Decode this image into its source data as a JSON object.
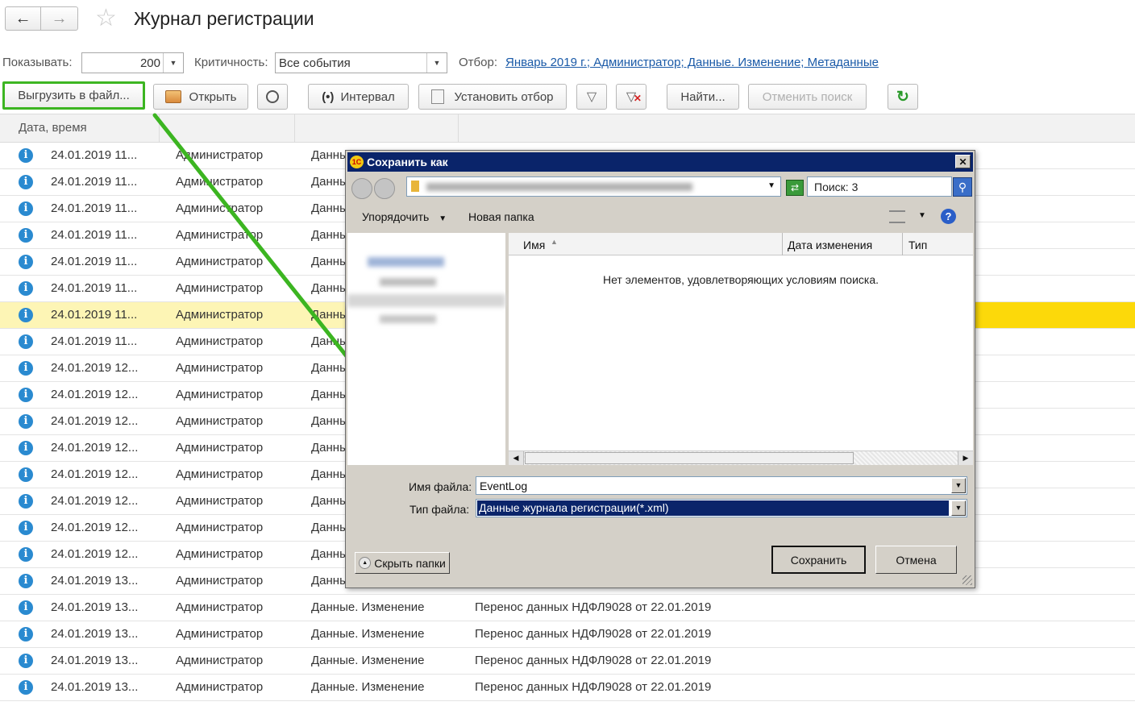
{
  "header": {
    "title": "Журнал регистрации"
  },
  "filters": {
    "show_label": "Показывать:",
    "show_value": "200",
    "severity_label": "Критичность:",
    "severity_value": "Все события",
    "filter_label": "Отбор:",
    "filter_value": "Январь 2019 г.; Администратор; Данные. Изменение; Метаданные"
  },
  "toolbar": {
    "export": "Выгрузить в файл...",
    "open": "Открыть",
    "interval": "Интервал",
    "set_filter": "Установить отбор",
    "find": "Найти...",
    "cancel_search": "Отменить поиск"
  },
  "table": {
    "columns": [
      "Дата, время"
    ],
    "rows": [
      {
        "date": "24.01.2019 11...",
        "user": "Администратор",
        "event": "Данные. Изменение",
        "comment": ""
      },
      {
        "date": "24.01.2019 11...",
        "user": "Администратор",
        "event": "Данные. Изменение",
        "comment": ""
      },
      {
        "date": "24.01.2019 11...",
        "user": "Администратор",
        "event": "Данные. Изменение",
        "comment": ""
      },
      {
        "date": "24.01.2019 11...",
        "user": "Администратор",
        "event": "Данные. Изменение",
        "comment": ""
      },
      {
        "date": "24.01.2019 11...",
        "user": "Администратор",
        "event": "Данные. Изменение",
        "comment": ""
      },
      {
        "date": "24.01.2019 11...",
        "user": "Администратор",
        "event": "Данные. Изменение",
        "comment": ""
      },
      {
        "date": "24.01.2019 11...",
        "user": "Администратор",
        "event": "Данные. Изменение",
        "comment": "",
        "selected": true
      },
      {
        "date": "24.01.2019 11...",
        "user": "Администратор",
        "event": "Данные. Изменение",
        "comment": ""
      },
      {
        "date": "24.01.2019 12...",
        "user": "Администратор",
        "event": "Данные. Изменение",
        "comment": ""
      },
      {
        "date": "24.01.2019 12...",
        "user": "Администратор",
        "event": "Данные. Изменение",
        "comment": ""
      },
      {
        "date": "24.01.2019 12...",
        "user": "Администратор",
        "event": "Данные. Изменение",
        "comment": ""
      },
      {
        "date": "24.01.2019 12...",
        "user": "Администратор",
        "event": "Данные. Изменение",
        "comment": ""
      },
      {
        "date": "24.01.2019 12...",
        "user": "Администратор",
        "event": "Данные. Изменение",
        "comment": ""
      },
      {
        "date": "24.01.2019 12...",
        "user": "Администратор",
        "event": "Данные. Изменение",
        "comment": ""
      },
      {
        "date": "24.01.2019 12...",
        "user": "Администратор",
        "event": "Данные. Изменение",
        "comment": ""
      },
      {
        "date": "24.01.2019 12...",
        "user": "Администратор",
        "event": "Данные. Изменение",
        "comment": ""
      },
      {
        "date": "24.01.2019 13...",
        "user": "Администратор",
        "event": "Данные. Изменение",
        "comment": ""
      },
      {
        "date": "24.01.2019 13...",
        "user": "Администратор",
        "event": "Данные. Изменение",
        "comment": "Перенос данных НДФЛ9028 от 22.01.2019"
      },
      {
        "date": "24.01.2019 13...",
        "user": "Администратор",
        "event": "Данные. Изменение",
        "comment": "Перенос данных НДФЛ9028 от 22.01.2019"
      },
      {
        "date": "24.01.2019 13...",
        "user": "Администратор",
        "event": "Данные. Изменение",
        "comment": "Перенос данных НДФЛ9028 от 22.01.2019"
      },
      {
        "date": "24.01.2019 13...",
        "user": "Администратор",
        "event": "Данные. Изменение",
        "comment": "Перенос данных НДФЛ9028 от 22.01.2019"
      }
    ]
  },
  "dialog": {
    "title": "Сохранить как",
    "search_placeholder": "Поиск: 3",
    "organize": "Упорядочить",
    "new_folder": "Новая папка",
    "col_name": "Имя",
    "col_date": "Дата изменения",
    "col_type": "Тип",
    "empty_message": "Нет элементов, удовлетворяющих условиям поиска.",
    "filename_label": "Имя файла:",
    "filename_value": "EventLog",
    "filetype_label": "Тип файла:",
    "filetype_value": "Данные журнала регистрации(*.xml)",
    "hide_folders": "Скрыть папки",
    "save": "Сохранить",
    "cancel": "Отмена"
  },
  "colors": {
    "accent_green": "#3cb521",
    "selection_yellow": "#fcd90a",
    "title_bar": "#0a246a",
    "link": "#1a5aa8"
  }
}
